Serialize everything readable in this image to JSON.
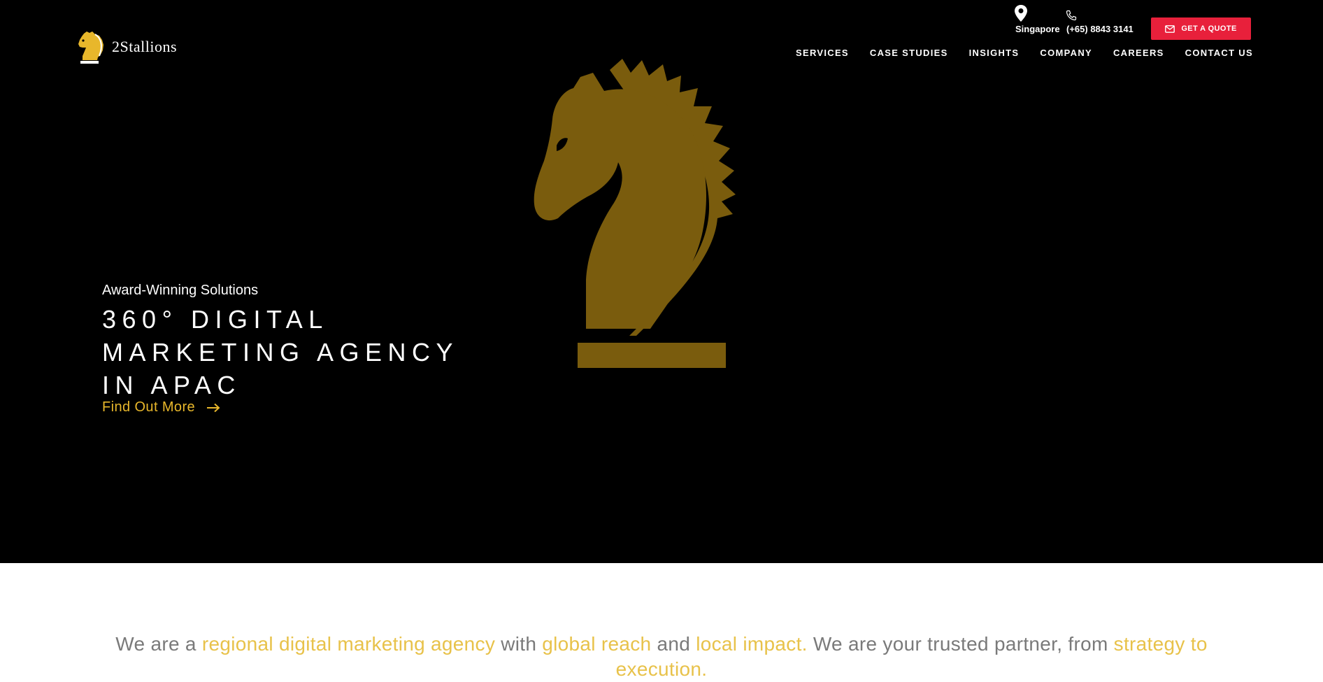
{
  "header": {
    "logo_text": "2Stallions",
    "location": "Singapore",
    "phone": "(+65) 8843 3141",
    "quote_button": "GET A QUOTE",
    "nav": [
      "SERVICES",
      "CASE STUDIES",
      "INSIGHTS",
      "COMPANY",
      "CAREERS",
      "CONTACT US"
    ]
  },
  "hero": {
    "kicker": "Award-Winning Solutions",
    "headline_1": "360° DIGITAL",
    "headline_2": "MARKETING AGENCY",
    "headline_3": "IN APAC",
    "cta": "Find Out More"
  },
  "intro": {
    "p1": "We are a ",
    "h1": "regional digital marketing agency",
    "p2": " with ",
    "h2": "global reach",
    "p3": " and ",
    "h3": "local impact.",
    "p4": " We are your trusted partner, from ",
    "h4": "strategy to execution."
  },
  "colors": {
    "accent_gold": "#e8b72b",
    "horse_gold": "#7a5c0d",
    "quote_red": "#e8203b",
    "hero_bg": "#000000"
  },
  "icons": [
    "map-pin-icon",
    "phone-icon",
    "envelope-icon",
    "arrow-right-icon",
    "horse-logo-icon"
  ]
}
